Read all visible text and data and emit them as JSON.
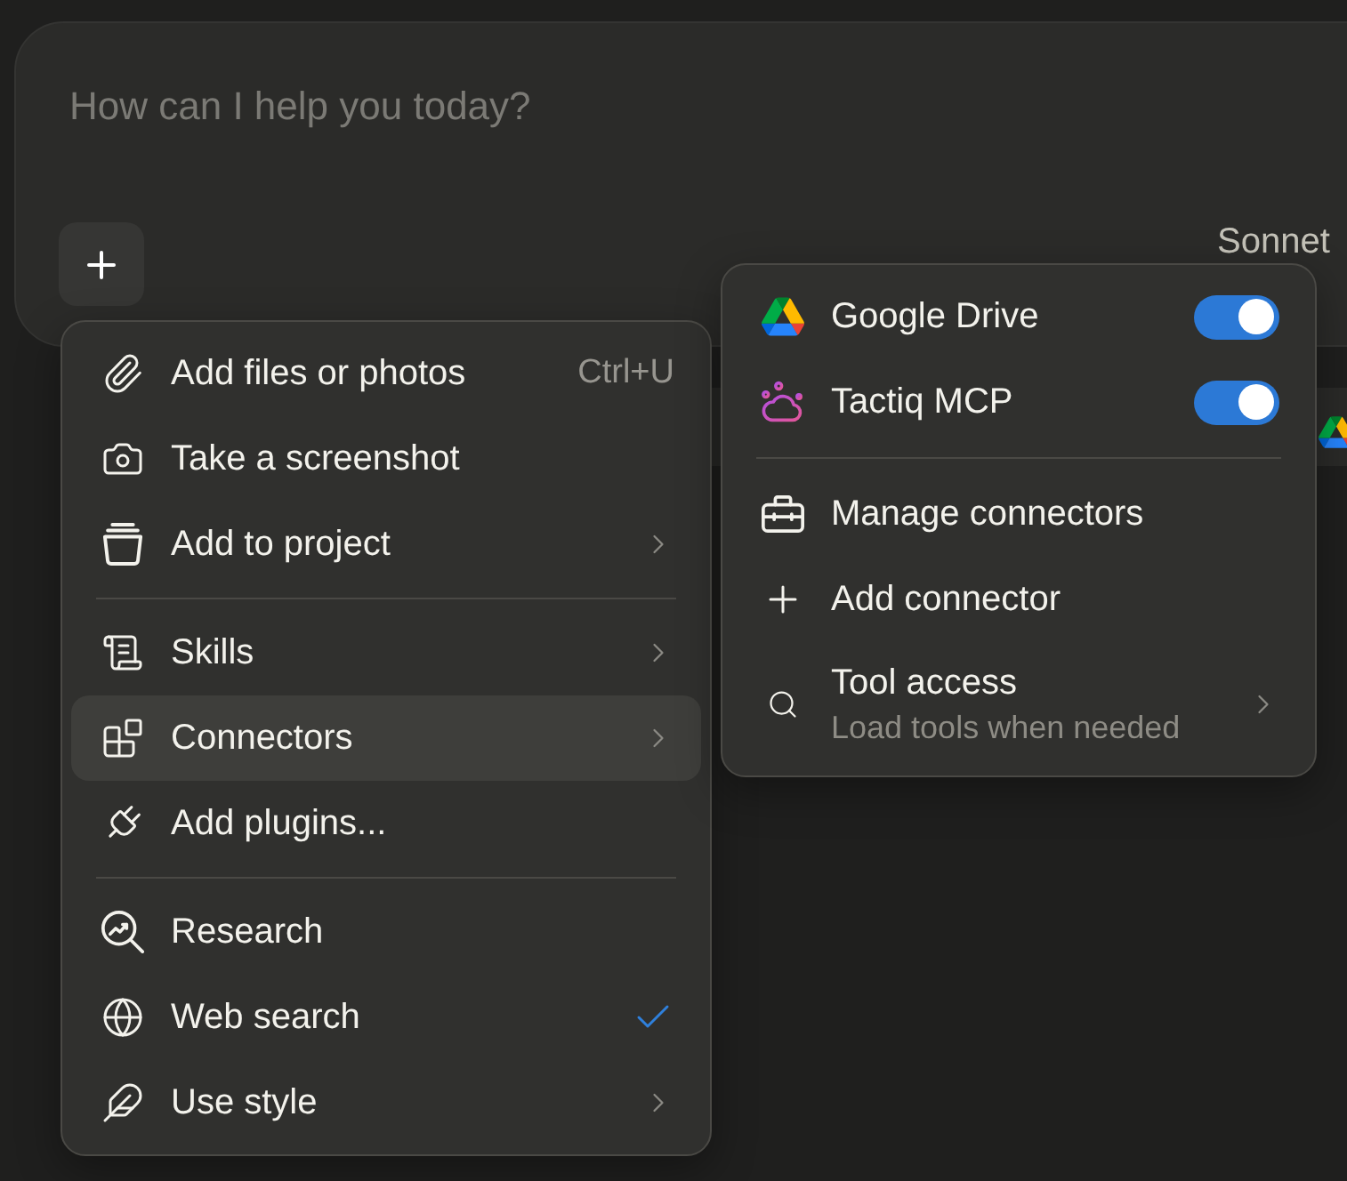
{
  "composer": {
    "placeholder": "How can I help you today?",
    "model": "Sonnet"
  },
  "menu": {
    "groups": [
      {
        "items": [
          {
            "kind": "action",
            "label": "Add files or photos",
            "shortcut": "Ctrl+U",
            "selected": false
          },
          {
            "kind": "action",
            "label": "Take a screenshot",
            "selected": false
          },
          {
            "kind": "submenu",
            "label": "Add to project",
            "selected": false
          }
        ]
      },
      {
        "items": [
          {
            "kind": "submenu",
            "label": "Skills",
            "selected": false
          },
          {
            "kind": "submenu",
            "label": "Connectors",
            "selected": true
          },
          {
            "kind": "action",
            "label": "Add plugins...",
            "selected": false
          }
        ]
      },
      {
        "items": [
          {
            "kind": "toggle",
            "label": "Research",
            "checked": false,
            "selected": false
          },
          {
            "kind": "toggle",
            "label": "Web search",
            "checked": true,
            "selected": false
          },
          {
            "kind": "submenu",
            "label": "Use style",
            "selected": false
          }
        ]
      }
    ]
  },
  "connectors_menu": {
    "connectors": [
      {
        "name": "Google Drive",
        "on": true
      },
      {
        "name": "Tactiq MCP",
        "on": true
      }
    ],
    "items": [
      {
        "kind": "action",
        "label": "Manage connectors"
      },
      {
        "kind": "action",
        "label": "Add connector"
      },
      {
        "kind": "submenu",
        "label": "Tool access",
        "description": "Load tools when needed"
      }
    ]
  }
}
